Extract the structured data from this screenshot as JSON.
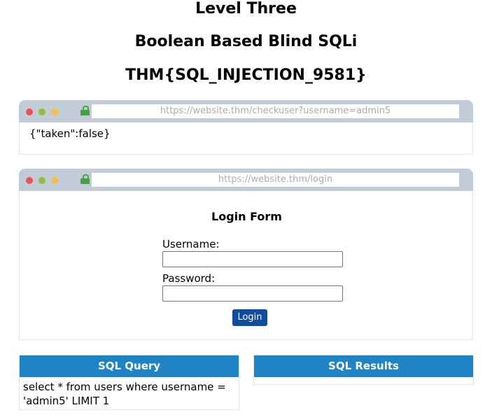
{
  "headings": {
    "level": "Level Three",
    "type": "Boolean Based Blind SQLi",
    "flag": "THM{SQL_INJECTION_9581}"
  },
  "browser_check": {
    "url": "https://website.thm/checkuser?username=admin5",
    "response": "{\"taken\":false}"
  },
  "browser_login": {
    "url": "https://website.thm/login",
    "form_title": "Login Form",
    "username_label": "Username:",
    "username_value": "",
    "password_label": "Password:",
    "password_value": "",
    "login_button": "Login"
  },
  "sql_query": {
    "title": "SQL Query",
    "text": "select * from users where username = 'admin5' LIMIT 1"
  },
  "sql_results": {
    "title": "SQL Results"
  },
  "colors": {
    "browser_bar": "#c1ccd6",
    "panel_header": "#1f84c6",
    "login_button": "#0f4da2",
    "lock": "#44a340"
  }
}
